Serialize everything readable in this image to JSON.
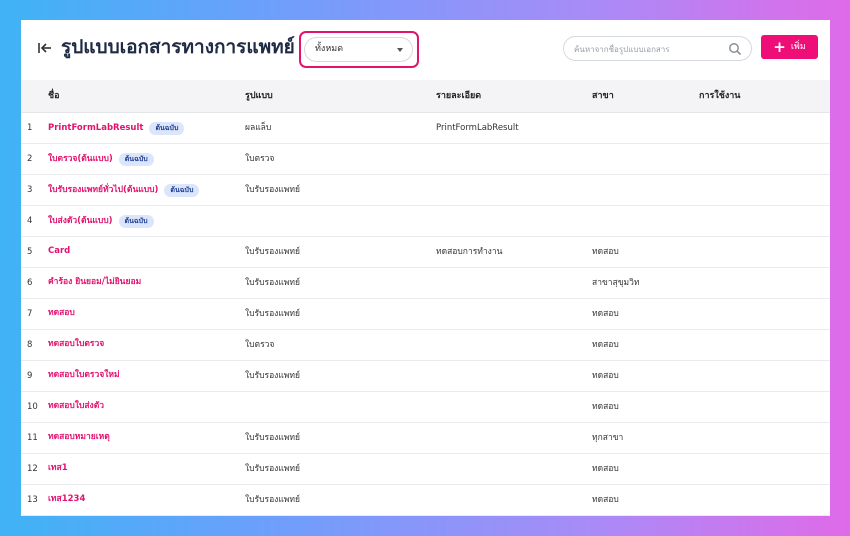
{
  "header": {
    "title": "รูปแบบเอกสารทางการแพทย์",
    "filter": {
      "value": "ทั้งหมด"
    },
    "search": {
      "placeholder": "ค้นหาจากชื่อรูปแบบเอกสาร"
    },
    "add_label": "เพิ่ม"
  },
  "colors": {
    "accent": "#ef0d78",
    "link": "#e3126f",
    "badge_bg": "#dbe5fb",
    "title": "#1f2a44"
  },
  "table": {
    "columns": [
      "ชื่อ",
      "รูปแบบ",
      "รายละเอียด",
      "สาขา",
      "การใช้งาน"
    ],
    "rows": [
      {
        "num": "1",
        "name": "PrintFormLabResult",
        "badge": "ต้นฉบับ",
        "format": "ผลแล็บ",
        "detail": "PrintFormLabResult",
        "branch": "",
        "usage": ""
      },
      {
        "num": "2",
        "name": "ใบตรวจ(ต้นแบบ)",
        "badge": "ต้นฉบับ",
        "format": "ใบตรวจ",
        "detail": "",
        "branch": "",
        "usage": ""
      },
      {
        "num": "3",
        "name": "ใบรับรองแพทย์ทั่วไป(ต้นแบบ)",
        "badge": "ต้นฉบับ",
        "format": "ใบรับรองแพทย์",
        "detail": "",
        "branch": "",
        "usage": ""
      },
      {
        "num": "4",
        "name": "ใบส่งตัว(ต้นแบบ)",
        "badge": "ต้นฉบับ",
        "format": "",
        "detail": "",
        "branch": "",
        "usage": ""
      },
      {
        "num": "5",
        "name": "Card",
        "badge": "",
        "format": "ใบรับรองแพทย์",
        "detail": "ทดสอบการทำงาน",
        "branch": "ทดสอบ",
        "usage": ""
      },
      {
        "num": "6",
        "name": "คำร้อง ยินยอม/ไม่ยินยอม",
        "badge": "",
        "format": "ใบรับรองแพทย์",
        "detail": "",
        "branch": "สาขาสุขุมวิท",
        "usage": ""
      },
      {
        "num": "7",
        "name": "ทดสอบ",
        "badge": "",
        "format": "ใบรับรองแพทย์",
        "detail": "",
        "branch": "ทดสอบ",
        "usage": ""
      },
      {
        "num": "8",
        "name": "ทดสอบใบตรวจ",
        "badge": "",
        "format": "ใบตรวจ",
        "detail": "",
        "branch": "ทดสอบ",
        "usage": ""
      },
      {
        "num": "9",
        "name": "ทดสอบใบตรวจใหม่",
        "badge": "",
        "format": "ใบรับรองแพทย์",
        "detail": "",
        "branch": "ทดสอบ",
        "usage": ""
      },
      {
        "num": "10",
        "name": "ทดสอบใบส่งตัว",
        "badge": "",
        "format": "",
        "detail": "",
        "branch": "ทดสอบ",
        "usage": ""
      },
      {
        "num": "11",
        "name": "ทดสอบหมายเหตุ",
        "badge": "",
        "format": "ใบรับรองแพทย์",
        "detail": "",
        "branch": "ทุกสาขา",
        "usage": ""
      },
      {
        "num": "12",
        "name": "เทส1",
        "badge": "",
        "format": "ใบรับรองแพทย์",
        "detail": "",
        "branch": "ทดสอบ",
        "usage": ""
      },
      {
        "num": "13",
        "name": "เทส1234",
        "badge": "",
        "format": "ใบรับรองแพทย์",
        "detail": "",
        "branch": "ทดสอบ",
        "usage": ""
      }
    ]
  }
}
